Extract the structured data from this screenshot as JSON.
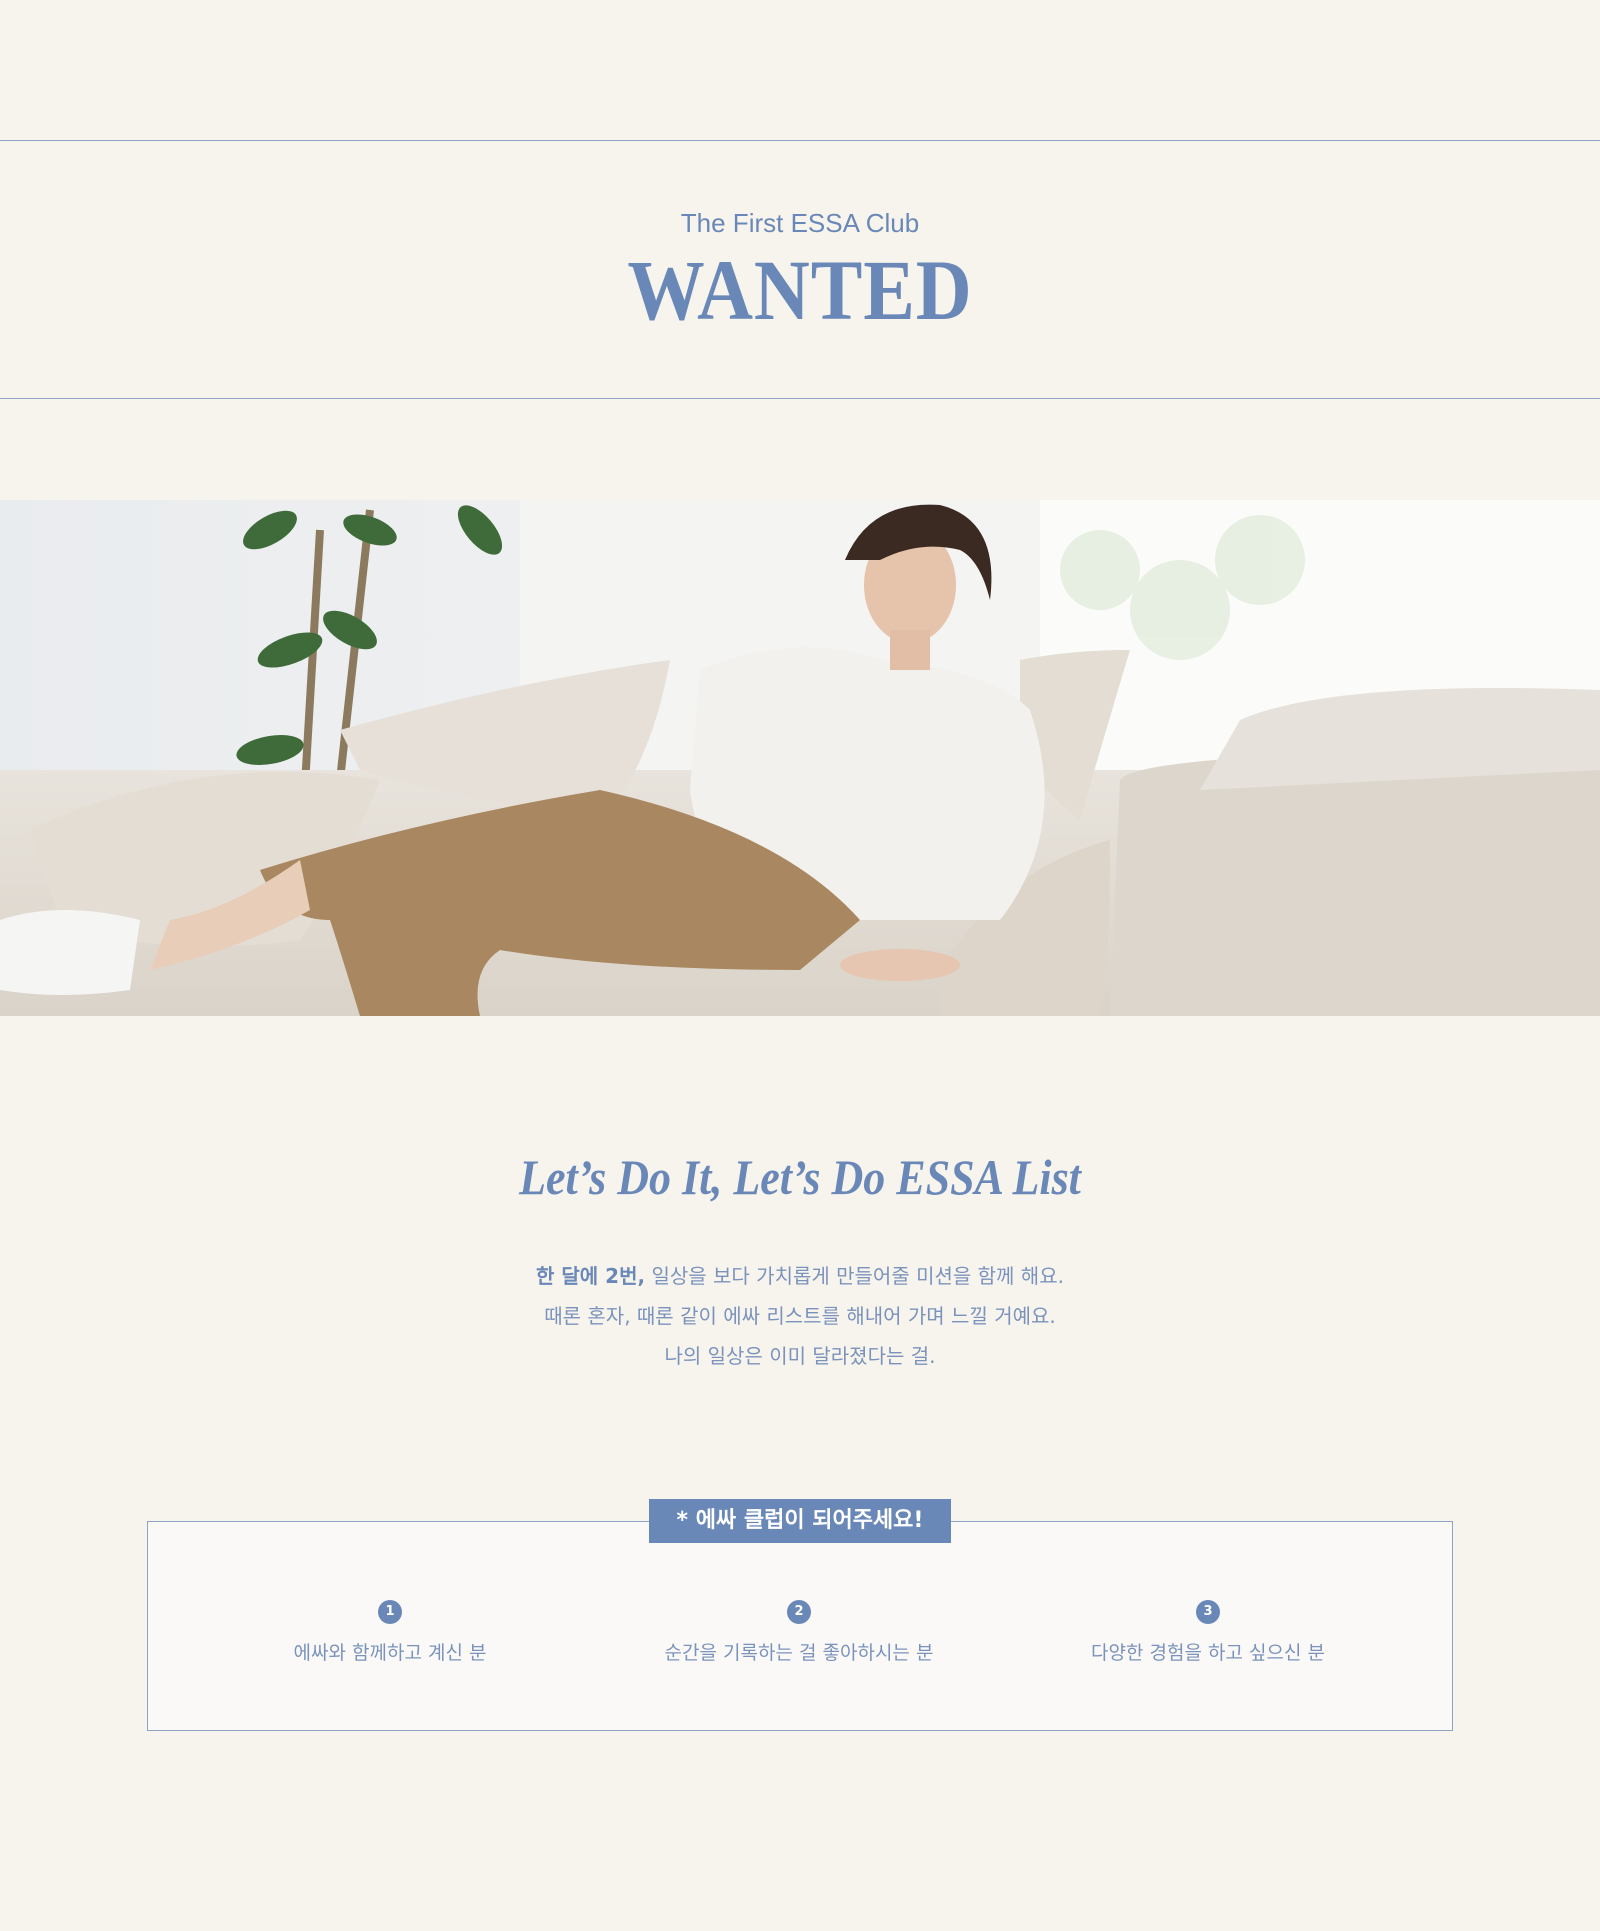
{
  "header": {
    "subtitle": "The First ESSA Club",
    "title": "WANTED"
  },
  "hero_image": {
    "description_icon": "photo-man-on-sofa"
  },
  "intro": {
    "tagline": "Let’s Do It,  Let’s Do ESSA List",
    "line1_bold": "한 달에 2번,",
    "line1_rest": " 일상을 보다 가치롭게 만들어줄 미션을 함께 해요.",
    "line2": "때론 혼자, 때론 같이 에싸 리스트를 해내어 가며 느낄 거예요.",
    "line3": "나의 일상은 이미 달라졌다는 걸."
  },
  "club": {
    "badge": "* 에싸 클럽이 되어주세요!",
    "items": [
      {
        "num": "1",
        "label": "에싸와 함께하고 계신 분"
      },
      {
        "num": "2",
        "label": "순간을 기록하는 걸 좋아하시는 분"
      },
      {
        "num": "3",
        "label": "다양한 경험을 하고 싶으신 분"
      }
    ]
  },
  "colors": {
    "background": "#f7f4ee",
    "accent": "#6a88b7",
    "rule": "#8ea3c6"
  }
}
